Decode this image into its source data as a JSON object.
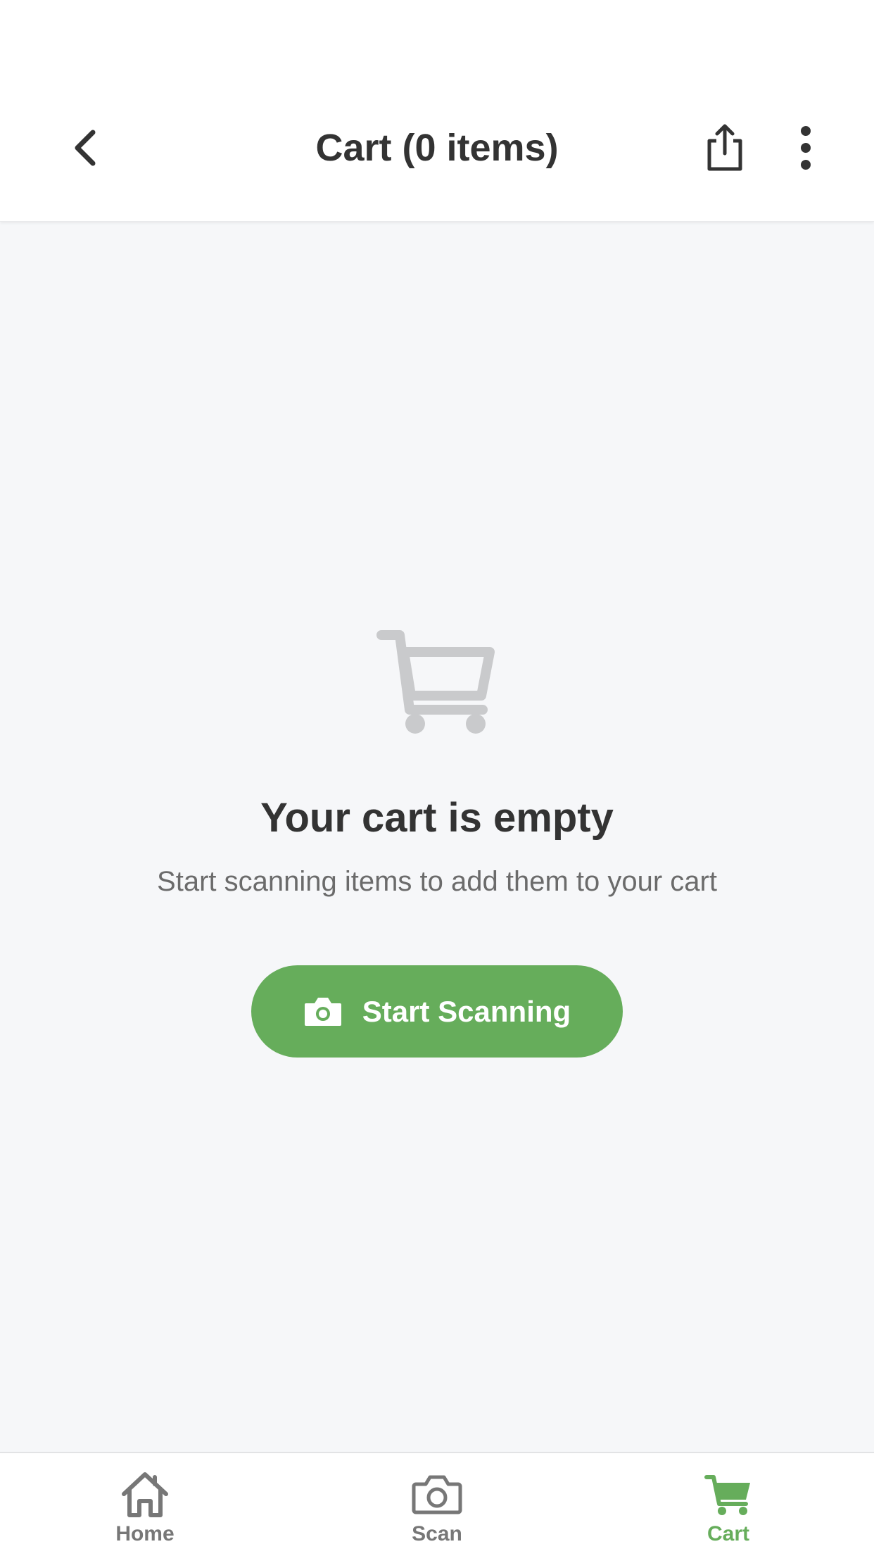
{
  "header": {
    "title": "Cart (0 items)",
    "back_icon": "chevron-left-icon",
    "share_icon": "share-icon",
    "more_icon": "more-vertical-icon"
  },
  "empty_state": {
    "icon": "shopping-cart-icon",
    "title": "Your cart is empty",
    "subtitle": "Start scanning items to add them to your cart",
    "button_label": "Start Scanning",
    "button_icon": "camera-icon"
  },
  "tabbar": {
    "items": [
      {
        "label": "Home",
        "icon": "home-icon",
        "active": false
      },
      {
        "label": "Scan",
        "icon": "camera-icon",
        "active": false
      },
      {
        "label": "Cart",
        "icon": "cart-icon",
        "active": true
      }
    ]
  },
  "colors": {
    "accent": "#66AD5B",
    "background": "#F6F7F9",
    "text_primary": "#333333",
    "text_secondary": "#6B6B6B",
    "inactive_tab": "#777777"
  }
}
